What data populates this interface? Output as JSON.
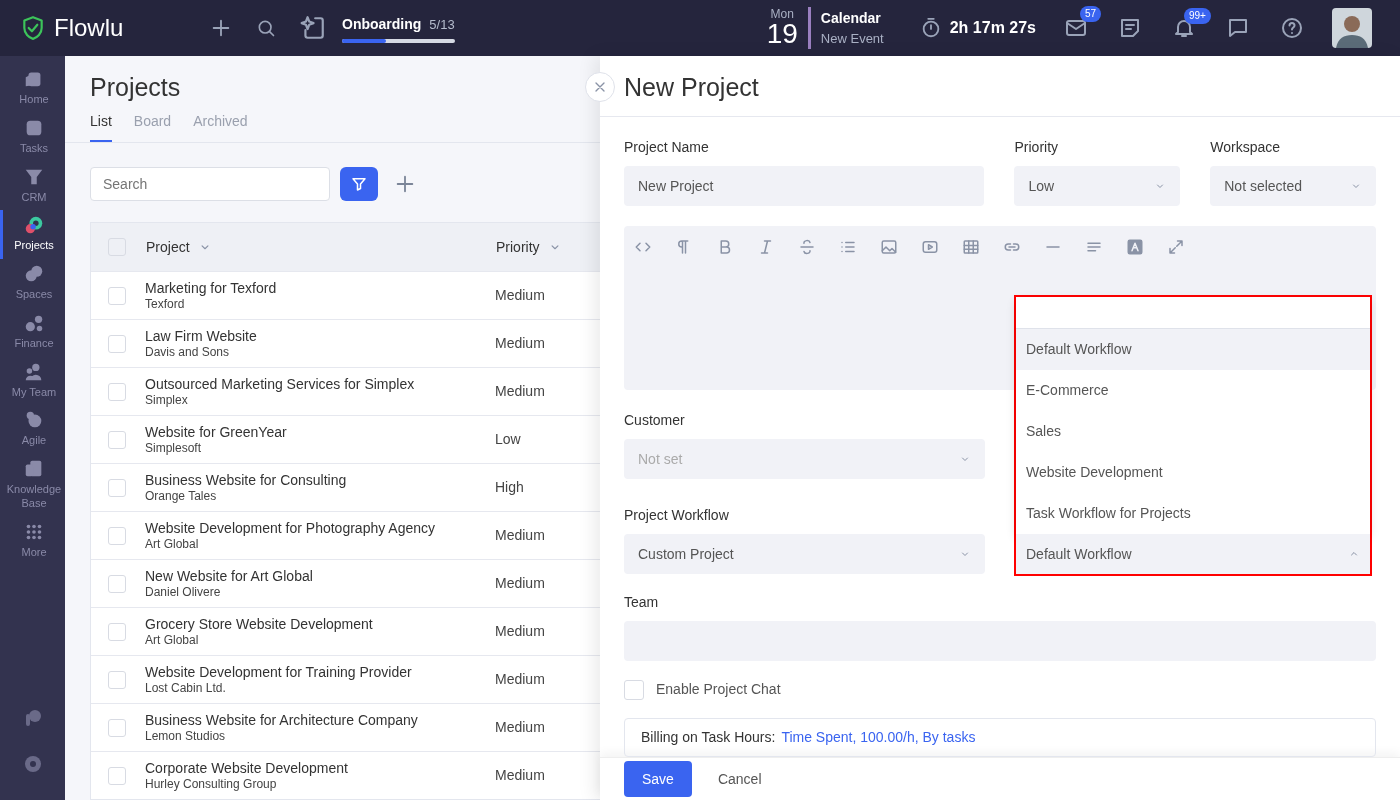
{
  "app": {
    "name": "Flowlu"
  },
  "onboarding": {
    "title": "Onboarding",
    "progress": "5/13",
    "level": 0.385
  },
  "calendar": {
    "weekday": "Mon",
    "day": "19",
    "title": "Calendar",
    "subtitle": "New Event"
  },
  "timer": "2h 17m 27s",
  "badges": {
    "mail": "57",
    "notifications": "99+"
  },
  "sidebar": {
    "items": [
      {
        "label": "Home",
        "selected": false
      },
      {
        "label": "Tasks",
        "selected": false
      },
      {
        "label": "CRM",
        "selected": false
      },
      {
        "label": "Projects",
        "selected": true
      },
      {
        "label": "Spaces",
        "selected": false
      },
      {
        "label": "Finance",
        "selected": false
      },
      {
        "label": "My Team",
        "selected": false
      },
      {
        "label": "Agile",
        "selected": false
      },
      {
        "label": "Knowledge Base",
        "selected": false
      },
      {
        "label": "More",
        "selected": false
      }
    ]
  },
  "projects": {
    "title": "Projects",
    "tabs": [
      {
        "label": "List",
        "selected": true
      },
      {
        "label": "Board",
        "selected": false
      },
      {
        "label": "Archived",
        "selected": false
      }
    ],
    "search": {
      "placeholder": "Search"
    },
    "select_all_checked": false,
    "columns": [
      "Project",
      "Priority"
    ],
    "rows": [
      {
        "name": "Marketing for Texford",
        "customer": "Texford",
        "priority": "Medium",
        "checked": false
      },
      {
        "name": "Law Firm Website",
        "customer": "Davis and Sons",
        "priority": "Medium",
        "checked": false
      },
      {
        "name": "Outsourced Marketing Services for Simplex",
        "customer": "Simplex",
        "priority": "Medium",
        "checked": false
      },
      {
        "name": "Website for GreenYear",
        "customer": "Simplesoft",
        "priority": "Low",
        "checked": false
      },
      {
        "name": "Business Website for Consulting",
        "customer": "Orange Tales",
        "priority": "High",
        "checked": false
      },
      {
        "name": "Website Development for Photography Agency",
        "customer": "Art Global",
        "priority": "Medium",
        "checked": false
      },
      {
        "name": "New Website for Art Global",
        "customer": "Daniel Olivere",
        "priority": "Medium",
        "checked": false
      },
      {
        "name": "Grocery Store Website Development",
        "customer": "Art Global",
        "priority": "Medium",
        "checked": false
      },
      {
        "name": "Website Development for Training Provider",
        "customer": "Lost Cabin Ltd.",
        "priority": "Medium",
        "checked": false
      },
      {
        "name": "Business Website for Architecture Company",
        "customer": "Lemon Studios",
        "priority": "Medium",
        "checked": false
      },
      {
        "name": "Corporate Website Development",
        "customer": "Hurley Consulting Group",
        "priority": "Medium",
        "checked": false
      }
    ]
  },
  "drawer": {
    "title": "New Project",
    "project_name": {
      "label": "Project Name",
      "value": "New Project"
    },
    "priority": {
      "label": "Priority",
      "value": "Low"
    },
    "workspace": {
      "label": "Workspace",
      "value": "Not selected"
    },
    "customer": {
      "label": "Customer",
      "value": "Not set",
      "disabled": true
    },
    "project_workflow": {
      "label": "Project Workflow",
      "value": "Custom Project"
    },
    "task_workflow": {
      "value": "Default Workflow",
      "expanded": true,
      "highlighted": true,
      "options": [
        {
          "label": "Default Workflow",
          "selected": true
        },
        {
          "label": "E-Commerce",
          "selected": false
        },
        {
          "label": "Sales",
          "selected": false
        },
        {
          "label": "Website Development",
          "selected": false
        },
        {
          "label": "Task Workflow for Projects",
          "selected": false
        }
      ]
    },
    "team": {
      "label": "Team"
    },
    "chat": {
      "label": "Enable Project Chat",
      "checked": false
    },
    "billing": {
      "label": "Billing on Task Hours:",
      "value": "Time Spent, 100.00/h, By tasks"
    },
    "buttons": [
      {
        "label": "Save",
        "kind": "primary"
      },
      {
        "label": "Cancel",
        "kind": "plain"
      }
    ]
  }
}
